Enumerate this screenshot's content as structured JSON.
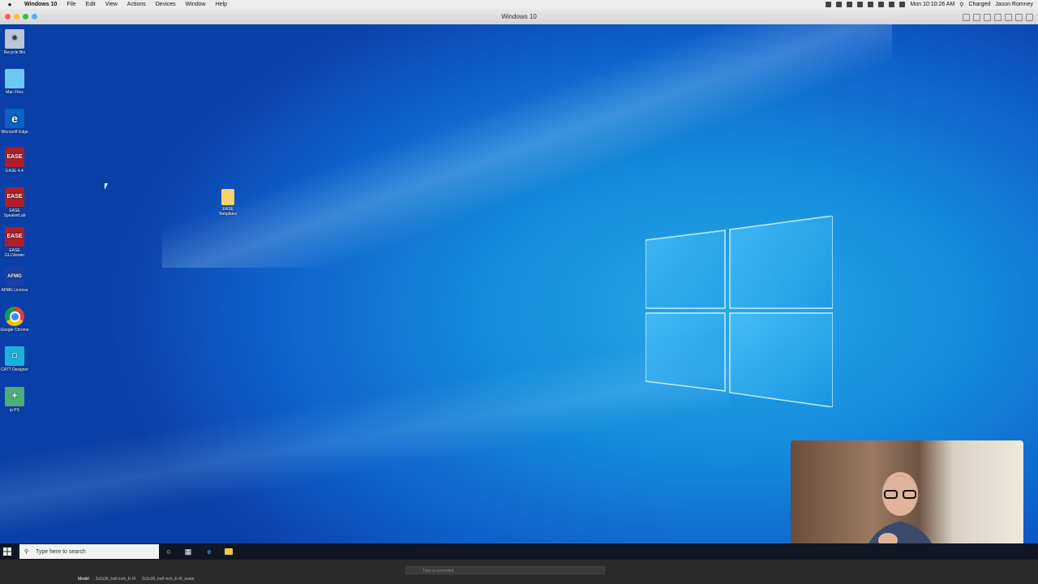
{
  "mac_menu": {
    "app": "Windows 10",
    "items": [
      "File",
      "Edit",
      "View",
      "Actions",
      "Devices",
      "Window",
      "Help"
    ],
    "clock": "Mon 10:10:26 AM",
    "battery": "Charged",
    "user": "Jason Romney"
  },
  "window": {
    "title": "Windows 10"
  },
  "desktop_icons": [
    {
      "label": "Recycle Bin",
      "icon": "recycle-bin-icon"
    },
    {
      "label": "Mac Files",
      "icon": "folder-icon"
    },
    {
      "label": "Microsoft Edge",
      "icon": "edge-icon"
    },
    {
      "label": "EASE 4.4",
      "icon": "ease-icon"
    },
    {
      "label": "EASE SpeakerLab",
      "icon": "ease-icon"
    },
    {
      "label": "EASE GLLViewer",
      "icon": "ease-icon"
    },
    {
      "label": "AFMG License",
      "icon": "afmg-icon"
    },
    {
      "label": "Google Chrome",
      "icon": "chrome-icon"
    },
    {
      "label": "CATT Designer",
      "icon": "designer-icon"
    },
    {
      "label": "ip PS",
      "icon": "app-icon"
    },
    {
      "label": "EASE Templates",
      "icon": "folder-icon"
    }
  ],
  "taskbar": {
    "search_placeholder": "Type here to search"
  },
  "statusbar": {
    "command_placeholder": "Type a command",
    "tabs": [
      "Model",
      "2x2x36_half inch_E-III",
      "2x2x36_half inch_E-III_seats"
    ]
  },
  "colors": {
    "desktop_accent": "#148bdc",
    "taskbar": "#101624",
    "mac_close": "#fc5f57",
    "mac_min": "#fdbc2e",
    "mac_max": "#28c840"
  }
}
